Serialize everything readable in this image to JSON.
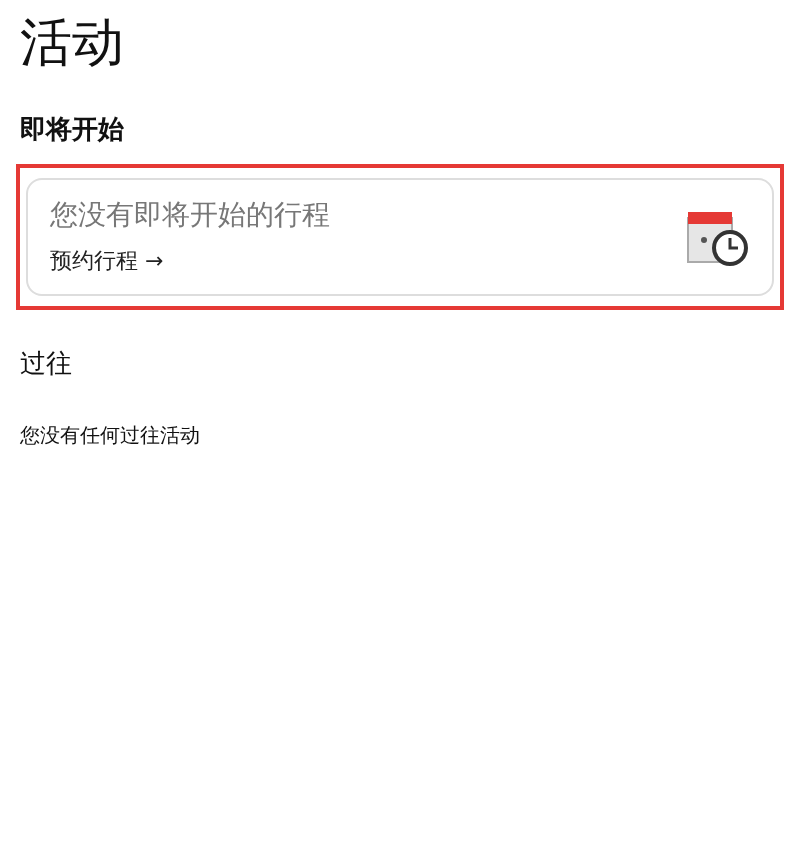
{
  "title": "活动",
  "upcoming": {
    "heading": "即将开始",
    "highlighted": true,
    "message": "您没有即将开始的行程",
    "link": "预约行程 →"
  },
  "past": {
    "heading": "过往",
    "message": "您没有任何过往活动"
  }
}
